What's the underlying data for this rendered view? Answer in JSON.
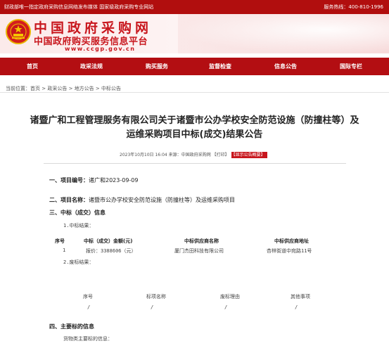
{
  "topbar": {
    "left_text": "财政部唯一指定政府采购信息网络发布媒体 国家级政府采购专业网站",
    "right_text": "服务热线：400-810-1996"
  },
  "header": {
    "logo_title": "中国政府采购网",
    "logo_subtitle": "中国政府购买服务信息平台",
    "logo_url": "www.ccgp.gov.cn"
  },
  "nav": {
    "items": [
      "首页",
      "政采法规",
      "购买服务",
      "监督检查",
      "信息公告",
      "国际专栏"
    ]
  },
  "breadcrumb": {
    "prefix": "当前位置：",
    "path": [
      "首页",
      "政采公告",
      "地方公告",
      "中标公告"
    ]
  },
  "article": {
    "title_line1": "诸暨广和工程管理服务有限公司关于诸暨市公办学校安全防范设施（防撞柱等）及",
    "title_line2": "运维采购项目中标(成交)结果公告",
    "date": "2023年10月10日 16:04",
    "source_label": "来源：",
    "source": "中国政府采购网",
    "print_label": "【打印】",
    "announce_label": "【显示公告概要】",
    "sec1_label": "一、项目编号：",
    "sec1_value": "诸广和2023-09-09",
    "sec2_label": "二、项目名称：",
    "sec2_value": "诸暨市公办学校安全防范设施（防撞柱等）及运维采购项目",
    "sec3_label": "三、中标（成交）信息",
    "sub1": "1.中标结果：",
    "result_headers": [
      "序号",
      "中标（成交）金额(元)",
      "中标供应商名称",
      "中标供应商地址"
    ],
    "result_row": {
      "index": "1",
      "amount": "报价：3388606（元）",
      "supplier": "厦门杰田科技有限公司",
      "address": "杏林街道中宛路11号"
    },
    "sub2": "2.废标结果：",
    "void_headers": [
      "序号",
      "标项名称",
      "废标理由",
      "其他事项"
    ],
    "void_row": [
      "/",
      "/",
      "/",
      "/"
    ],
    "sec4_label": "四、主要标的信息",
    "sec4_sub": "货物类主要标的信息："
  }
}
